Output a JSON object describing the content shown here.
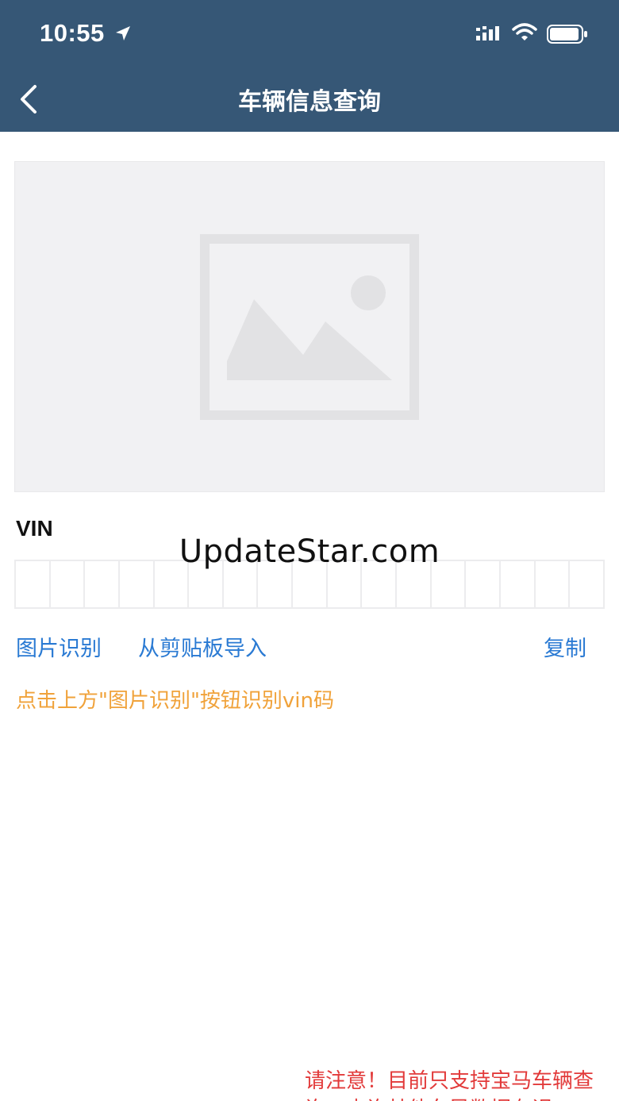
{
  "status_bar": {
    "time": "10:55",
    "icons": [
      "location-arrow-icon",
      "cellular-signal-icon",
      "wifi-icon",
      "battery-icon"
    ]
  },
  "nav": {
    "back_icon": "chevron-left-icon",
    "title": "车辆信息查询"
  },
  "image_placeholder": {
    "icon": "image-placeholder-icon"
  },
  "vin": {
    "label": "VIN",
    "cells": [
      "",
      "",
      "",
      "",
      "",
      "",
      "",
      "",
      "",
      "",
      "",
      "",
      "",
      "",
      "",
      "",
      ""
    ]
  },
  "watermark": "UpdateStar.com",
  "actions": {
    "image_recognition": "图片识别",
    "import_clipboard": "从剪贴板导入",
    "copy": "复制"
  },
  "hint": "点击上方\"图片识别\"按钮识别vin码",
  "notice": "请注意！目前只支持宝马车辆查询，查询其他车导数据有误",
  "colors": {
    "header_bg": "#365776",
    "link": "#2a7ad3",
    "hint": "#f0a23a",
    "notice": "#e23a3a"
  }
}
